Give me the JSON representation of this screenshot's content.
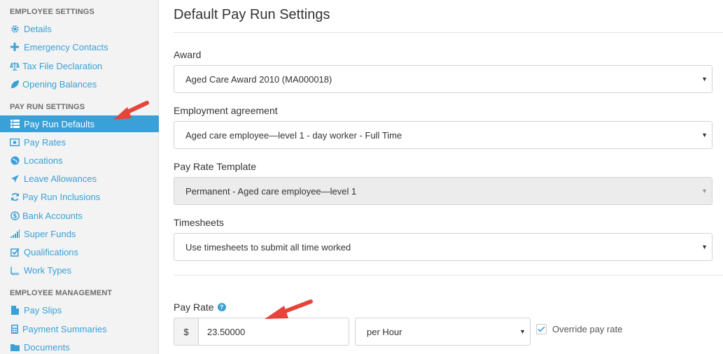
{
  "sidebar": {
    "sections": [
      {
        "heading": "EMPLOYEE SETTINGS",
        "items": [
          {
            "label": "Details",
            "icon": "gear-icon"
          },
          {
            "label": "Emergency Contacts",
            "icon": "plus-icon"
          },
          {
            "label": "Tax File Declaration",
            "icon": "scale-icon"
          },
          {
            "label": "Opening Balances",
            "icon": "leaf-icon"
          }
        ]
      },
      {
        "heading": "PAY RUN SETTINGS",
        "items": [
          {
            "label": "Pay Run Defaults",
            "icon": "list-icon",
            "active": true
          },
          {
            "label": "Pay Rates",
            "icon": "money-icon"
          },
          {
            "label": "Locations",
            "icon": "globe-icon"
          },
          {
            "label": "Leave Allowances",
            "icon": "plane-icon"
          },
          {
            "label": "Pay Run Inclusions",
            "icon": "refresh-icon"
          },
          {
            "label": "Bank Accounts",
            "icon": "dollar-circle-icon"
          },
          {
            "label": "Super Funds",
            "icon": "signal-icon"
          },
          {
            "label": "Qualifications",
            "icon": "check-square-icon"
          },
          {
            "label": "Work Types",
            "icon": "book-icon"
          }
        ]
      },
      {
        "heading": "EMPLOYEE MANAGEMENT",
        "items": [
          {
            "label": "Pay Slips",
            "icon": "file-icon"
          },
          {
            "label": "Payment Summaries",
            "icon": "calculator-icon"
          },
          {
            "label": "Documents",
            "icon": "folder-icon"
          }
        ]
      }
    ]
  },
  "main": {
    "title": "Default Pay Run Settings",
    "award": {
      "label": "Award",
      "value": "Aged Care Award 2010 (MA000018)"
    },
    "agreement": {
      "label": "Employment agreement",
      "value": "Aged care employee—level 1 - day worker - Full Time"
    },
    "template": {
      "label": "Pay Rate Template",
      "value": "Permanent - Aged care employee—level 1"
    },
    "timesheets": {
      "label": "Timesheets",
      "value": "Use timesheets to submit all time worked"
    },
    "pay_rate": {
      "label": "Pay Rate",
      "currency": "$",
      "value": "23.50000",
      "unit": "per Hour",
      "override_label": "Override pay rate",
      "override_checked": true
    }
  },
  "colors": {
    "accent": "#3aa0d8",
    "annotation": "#e8433a"
  }
}
